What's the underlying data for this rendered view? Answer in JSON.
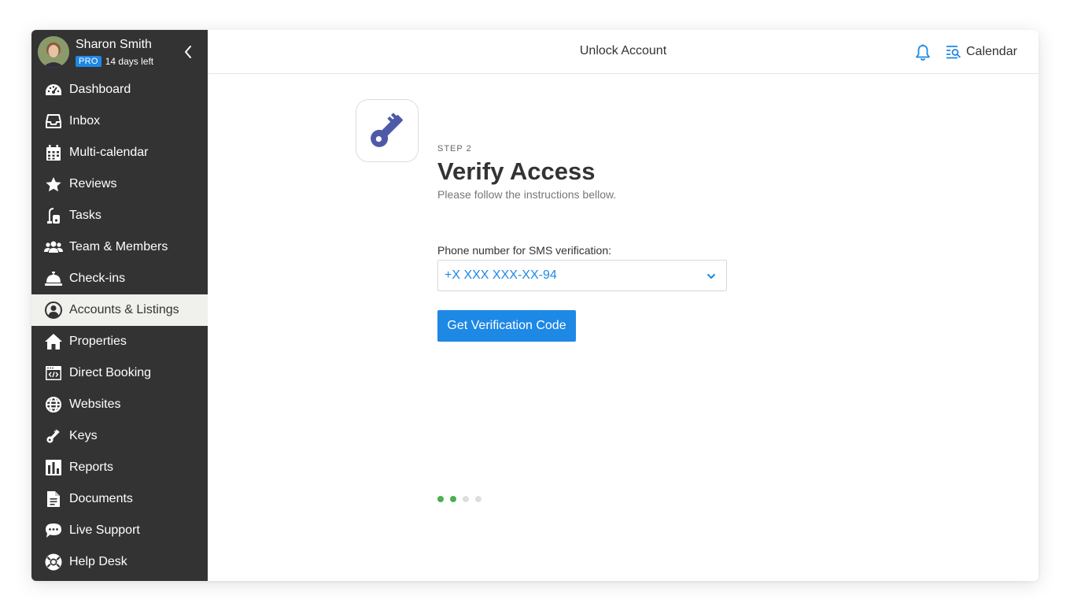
{
  "profile": {
    "name": "Sharon Smith",
    "badge": "PRO",
    "trial": "14 days left"
  },
  "sidebar": {
    "items": [
      {
        "label": "Dashboard",
        "icon": "gauge-icon"
      },
      {
        "label": "Inbox",
        "icon": "inbox-icon"
      },
      {
        "label": "Multi-calendar",
        "icon": "calendar-grid-icon"
      },
      {
        "label": "Reviews",
        "icon": "star-icon"
      },
      {
        "label": "Tasks",
        "icon": "vacuum-icon"
      },
      {
        "label": "Team & Members",
        "icon": "users-icon"
      },
      {
        "label": "Check-ins",
        "icon": "concierge-bell-icon"
      },
      {
        "label": "Accounts & Listings",
        "icon": "user-circle-icon",
        "active": true
      },
      {
        "label": "Properties",
        "icon": "home-icon"
      },
      {
        "label": "Direct Booking",
        "icon": "code-window-icon"
      },
      {
        "label": "Websites",
        "icon": "globe-icon"
      },
      {
        "label": "Keys",
        "icon": "key-icon"
      },
      {
        "label": "Reports",
        "icon": "bar-chart-icon"
      },
      {
        "label": "Documents",
        "icon": "document-icon"
      },
      {
        "label": "Live Support",
        "icon": "chat-bubble-icon"
      },
      {
        "label": "Help Desk",
        "icon": "lifebuoy-icon"
      }
    ]
  },
  "header": {
    "title": "Unlock Account",
    "calendar_label": "Calendar"
  },
  "content": {
    "step": "STEP 2",
    "heading": "Verify Access",
    "subheading": "Please follow the instructions bellow.",
    "field_label": "Phone number for SMS verification:",
    "phone_value": "+X XXX XXX-XX-94",
    "button_label": "Get Verification Code"
  },
  "progress": {
    "total_steps": 4,
    "completed_steps": 2
  },
  "colors": {
    "sidebar_bg": "#333333",
    "accent_blue": "#1e88e5",
    "key_icon": "#4e5aa8",
    "progress_done": "#4caf50",
    "progress_todo": "#dedede"
  }
}
